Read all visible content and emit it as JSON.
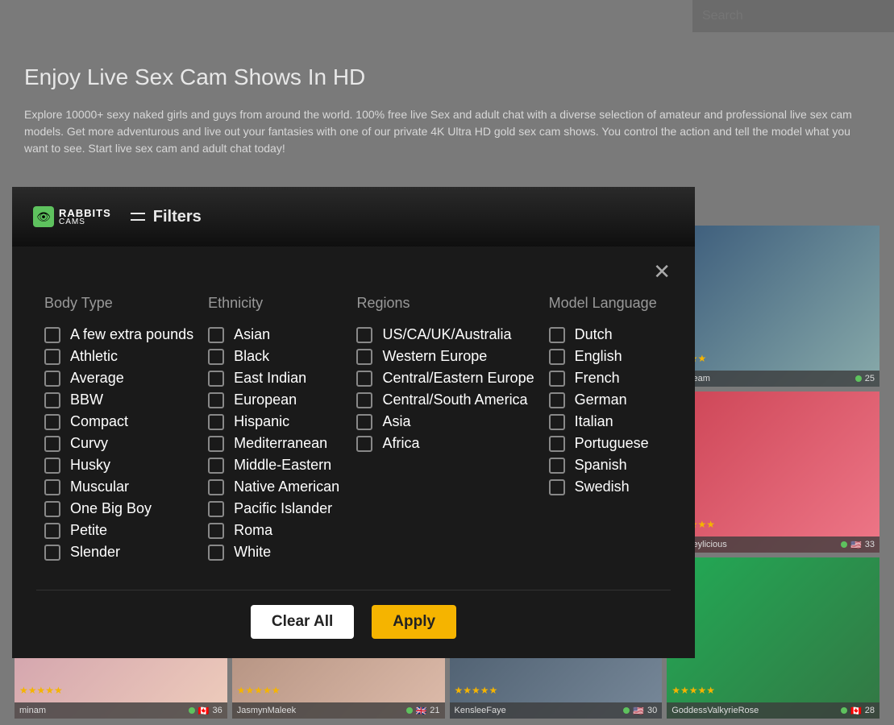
{
  "search": {
    "placeholder": "Search"
  },
  "hero": {
    "title": "Enjoy Live Sex Cam Shows In HD",
    "subtitle": "Explore 10000+ sexy naked girls and guys from around the world. 100% free live Sex and adult chat with a diverse selection of amateur and professional live sex cam models. Get more adventurous and live out your fantasies with one of our private 4K Ultra HD gold sex cam shows. You control the action and tell the model what you want to see. Start live sex cam and adult chat today!"
  },
  "logo": {
    "line1": "RABBITS",
    "line2": "CAMS"
  },
  "filters_label": "Filters",
  "columns": {
    "bodytype": {
      "title": "Body Type",
      "items": [
        "A few extra pounds",
        "Athletic",
        "Average",
        "BBW",
        "Compact",
        "Curvy",
        "Husky",
        "Muscular",
        "One Big Boy",
        "Petite",
        "Slender"
      ]
    },
    "ethnicity": {
      "title": "Ethnicity",
      "items": [
        "Asian",
        "Black",
        "East Indian",
        "European",
        "Hispanic",
        "Mediterranean",
        "Middle-Eastern",
        "Native American",
        "Pacific Islander",
        "Roma",
        "White"
      ]
    },
    "regions": {
      "title": "Regions",
      "items": [
        "US/CA/UK/Australia",
        "Western Europe",
        "Central/Eastern Europe",
        "Central/South America",
        "Asia",
        "Africa"
      ]
    },
    "language": {
      "title": "Model Language",
      "items": [
        "Dutch",
        "English",
        "French",
        "German",
        "Italian",
        "Portuguese",
        "Spanish",
        "Swedish"
      ]
    }
  },
  "buttons": {
    "clear": "Clear All",
    "apply": "Apply"
  },
  "cards": {
    "r1": [
      {
        "name": "niaDream",
        "flag": "",
        "count": "25"
      },
      {
        "name": "sJerseylicious",
        "flag": "🇺🇸",
        "count": "33"
      }
    ],
    "r2": [
      {
        "name": "minam",
        "flag": "🇨🇦",
        "count": "36"
      },
      {
        "name": "JasmynMaleek",
        "flag": "🇬🇧",
        "count": "21"
      },
      {
        "name": "KensleeFaye",
        "flag": "🇺🇸",
        "count": "30"
      },
      {
        "name": "GoddessValkyrieRose",
        "flag": "🇨🇦",
        "count": "28"
      }
    ]
  }
}
